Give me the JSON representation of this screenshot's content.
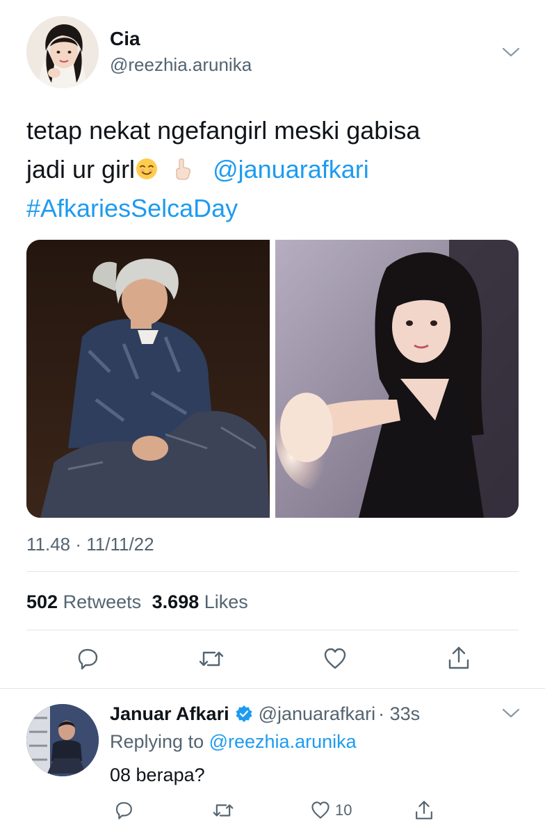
{
  "tweet": {
    "author": {
      "name": "Cia",
      "handle": "@reezhia.arunika"
    },
    "text": {
      "line1": "tetap nekat ngefangirl meski gabisa",
      "line2_prefix": "jadi ur girl",
      "emoji_1": "smiling-face-icon",
      "emoji_2": "index-pointing-up-icon",
      "mention": "@januarafkari",
      "hashtag": "#AfkariesSelcaDay"
    },
    "timestamp": "11.48 · 11/11/22",
    "stats": {
      "retweets_count": "502",
      "retweets_label": "Retweets",
      "likes_count": "3.698",
      "likes_label": "Likes"
    },
    "actions": [
      "reply-icon",
      "retweet-icon",
      "like-icon",
      "share-icon"
    ]
  },
  "reply": {
    "author": {
      "name": "Januar Afkari",
      "handle": "@januarafkari",
      "time": "· 33s"
    },
    "replying_label": "Replying to",
    "replying_handle": "@reezhia.arunika",
    "text": "08 berapa?",
    "like_count": "10"
  },
  "colors": {
    "link": "#1d9bf0",
    "secondary_text": "#536471",
    "primary_text": "#0f1419",
    "divider": "#e1e5e8"
  }
}
